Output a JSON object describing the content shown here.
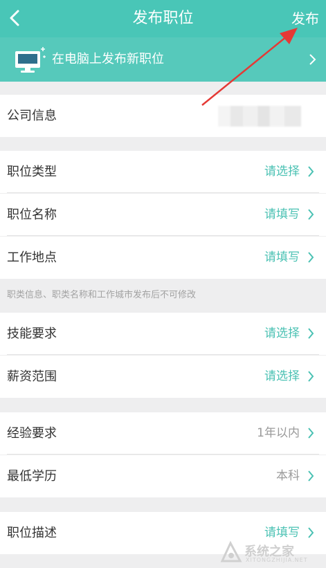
{
  "header": {
    "title": "发布职位",
    "publish_label": "发布"
  },
  "banner": {
    "text": "在电脑上发布新职位"
  },
  "company": {
    "label": "公司信息"
  },
  "group1": [
    {
      "label": "职位类型",
      "value": "请选择"
    },
    {
      "label": "职位名称",
      "value": "请填写"
    },
    {
      "label": "工作地点",
      "value": "请填写"
    }
  ],
  "note": "职类信息、职类名称和工作城市发布后不可修改",
  "group2": [
    {
      "label": "技能要求",
      "value": "请选择"
    },
    {
      "label": "薪资范围",
      "value": "请选择"
    }
  ],
  "group3": [
    {
      "label": "经验要求",
      "value": "1年以内"
    },
    {
      "label": "最低学历",
      "value": "本科"
    }
  ],
  "group4": [
    {
      "label": "职位描述",
      "value": "请填写"
    }
  ],
  "watermark": {
    "text": "系统之家",
    "sub": "XITONGZHIJIA.NET"
  },
  "colors": {
    "header_bg": "#49c6b7",
    "banner_bg": "#56c9bb",
    "accent": "#4ac1b3",
    "arrow": "#e53935"
  }
}
